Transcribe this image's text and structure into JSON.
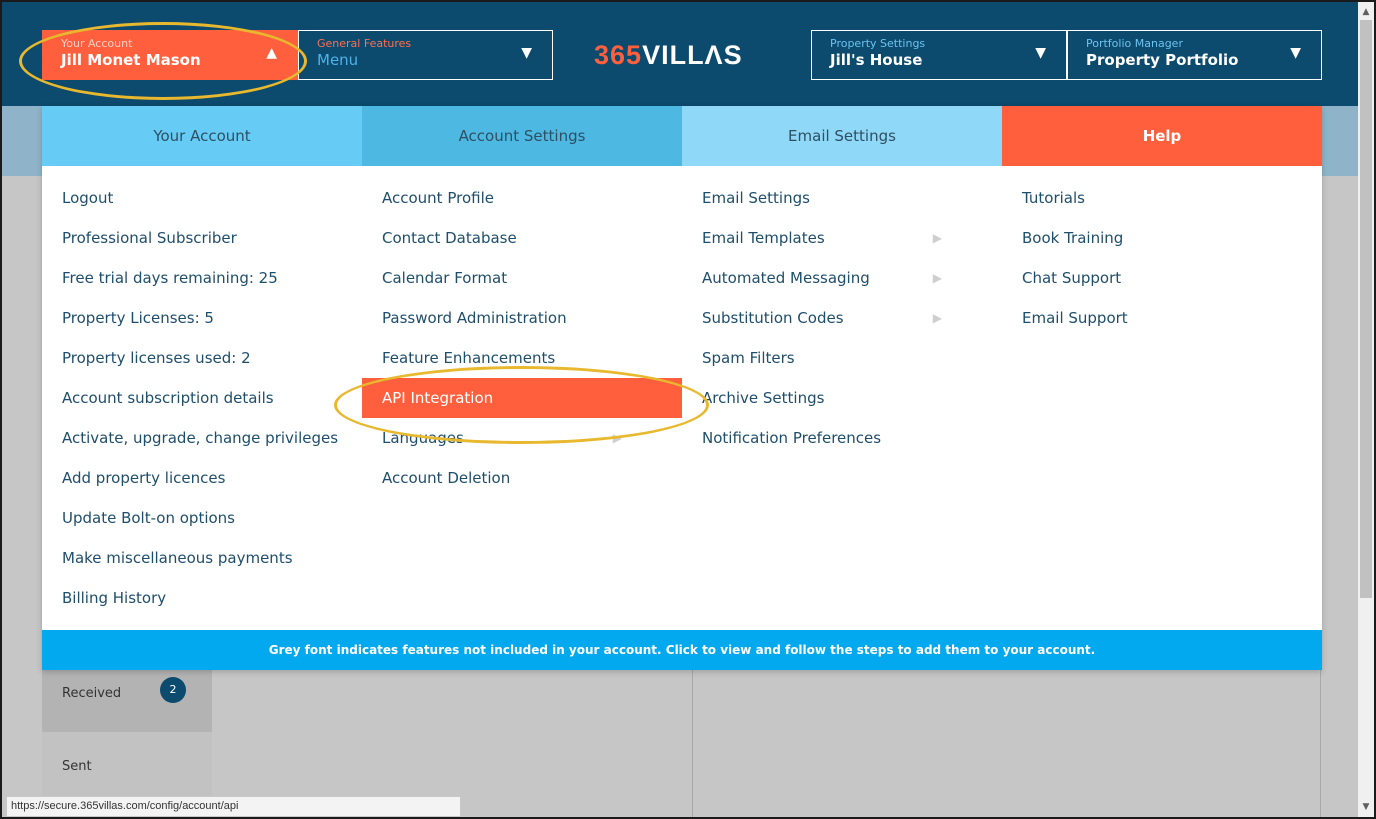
{
  "header": {
    "account": {
      "label": "Your Account",
      "value": "Jill Monet Mason"
    },
    "general": {
      "label": "General Features",
      "value": "Menu"
    },
    "logo": {
      "num": "365",
      "word": "VILLΛS"
    },
    "property": {
      "label": "Property Settings",
      "value": "Jill's House"
    },
    "portfolio": {
      "label": "Portfolio Manager",
      "value": "Property Portfolio"
    }
  },
  "tabs": [
    "Your Account",
    "Account Settings",
    "Email Settings",
    "Help"
  ],
  "columns": {
    "your_account": [
      "Logout",
      "Professional Subscriber",
      "Free trial days remaining: 25",
      "Property Licenses: 5",
      "Property licenses used: 2",
      "Account subscription details",
      "Activate, upgrade, change privileges",
      "Add property licences",
      "Update Bolt-on options",
      "Make miscellaneous payments",
      "Billing History"
    ],
    "account_settings": [
      "Account Profile",
      "Contact Database",
      "Calendar Format",
      "Password Administration",
      "Feature Enhancements",
      "API Integration",
      "Languages",
      "Account Deletion"
    ],
    "email_settings": [
      "Email Settings",
      "Email Templates",
      "Automated Messaging",
      "Substitution Codes",
      "Spam Filters",
      "Archive Settings",
      "Notification Preferences"
    ],
    "help": [
      "Tutorials",
      "Book Training",
      "Chat Support",
      "Email Support"
    ]
  },
  "footer_note": "Grey font indicates features not included in your account. Click to view and follow the steps to add them to your account.",
  "background": {
    "received": "Received",
    "received_count": "2",
    "sent": "Sent"
  },
  "status_url": "https://secure.365villas.com/config/account/api",
  "colors": {
    "accent": "#ff5f3c",
    "navy": "#0c4a6e",
    "sky": "#03a9ef",
    "highlight": "#e8b82e"
  }
}
